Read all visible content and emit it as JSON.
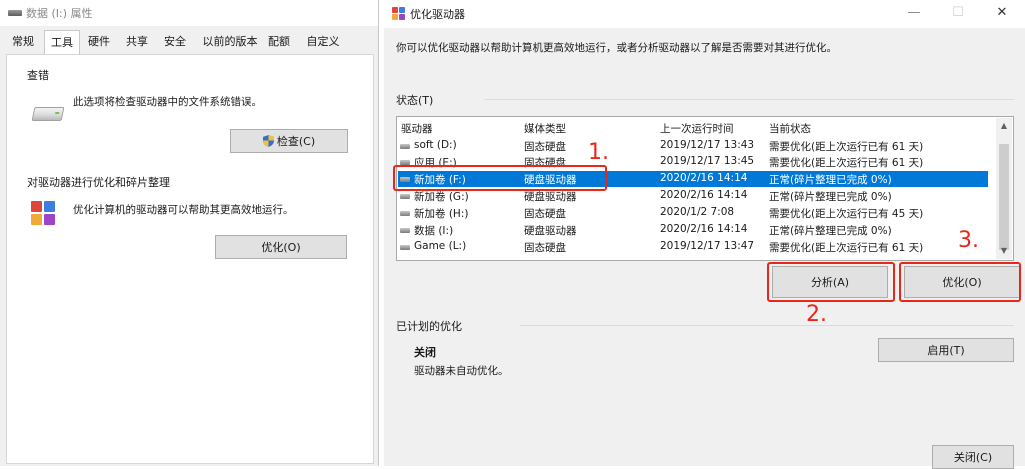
{
  "left_window": {
    "title": "数据 (I:) 属性",
    "tabs": [
      "常规",
      "工具",
      "硬件",
      "共享",
      "安全",
      "以前的版本",
      "配额",
      "自定义"
    ],
    "active_tab": "工具",
    "check": {
      "title": "查错",
      "description": "此选项将检查驱动器中的文件系统错误。",
      "button_label": "检查(C)"
    },
    "optimize": {
      "title": "对驱动器进行优化和碎片整理",
      "description": "优化计算机的驱动器可以帮助其更高效地运行。",
      "button_label": "优化(O)"
    }
  },
  "right_window": {
    "title": "优化驱动器",
    "window_controls": {
      "minimize": "—",
      "maximize": "☐",
      "close": "✕"
    },
    "intro": "你可以优化驱动器以帮助计算机更高效地运行，或者分析驱动器以了解是否需要对其进行优化。",
    "status_label": "状态(T)",
    "columns": [
      "驱动器",
      "媒体类型",
      "上一次运行时间",
      "当前状态"
    ],
    "drives": [
      {
        "name": "soft (D:)",
        "media": "固态硬盘",
        "last_run": "2019/12/17 13:43",
        "status": "需要优化(距上次运行已有 61 天)"
      },
      {
        "name": "应用 (E:)",
        "media": "固态硬盘",
        "last_run": "2019/12/17 13:45",
        "status": "需要优化(距上次运行已有 61 天)"
      },
      {
        "name": "新加卷 (F:)",
        "media": "硬盘驱动器",
        "last_run": "2020/2/16 14:14",
        "status": "正常(碎片整理已完成 0%)"
      },
      {
        "name": "新加卷 (G:)",
        "media": "硬盘驱动器",
        "last_run": "2020/2/16 14:14",
        "status": "正常(碎片整理已完成 0%)"
      },
      {
        "name": "新加卷 (H:)",
        "media": "固态硬盘",
        "last_run": "2020/1/2 7:08",
        "status": "需要优化(距上次运行已有 45 天)"
      },
      {
        "name": "数据 (I:)",
        "media": "硬盘驱动器",
        "last_run": "2020/2/16 14:14",
        "status": "正常(碎片整理已完成 0%)"
      },
      {
        "name": "Game (L:)",
        "media": "固态硬盘",
        "last_run": "2019/12/17 13:47",
        "status": "需要优化(距上次运行已有 61 天)"
      }
    ],
    "selected_drive": "新加卷 (F:)",
    "analyze_button": "分析(A)",
    "optimize_button": "优化(O)",
    "scheduled": {
      "section_label": "已计划的优化",
      "state": "关闭",
      "description": "驱动器未自动优化。",
      "enable_button": "启用(T)"
    },
    "close_button": "关闭(C)"
  },
  "annotations": {
    "step1": "1.",
    "step2": "2.",
    "step3": "3.",
    "color": "#e8271c"
  },
  "colors": {
    "selection": "#0078d7",
    "window_bg": "#f0f0f0",
    "button_bg": "#e1e1e1"
  }
}
